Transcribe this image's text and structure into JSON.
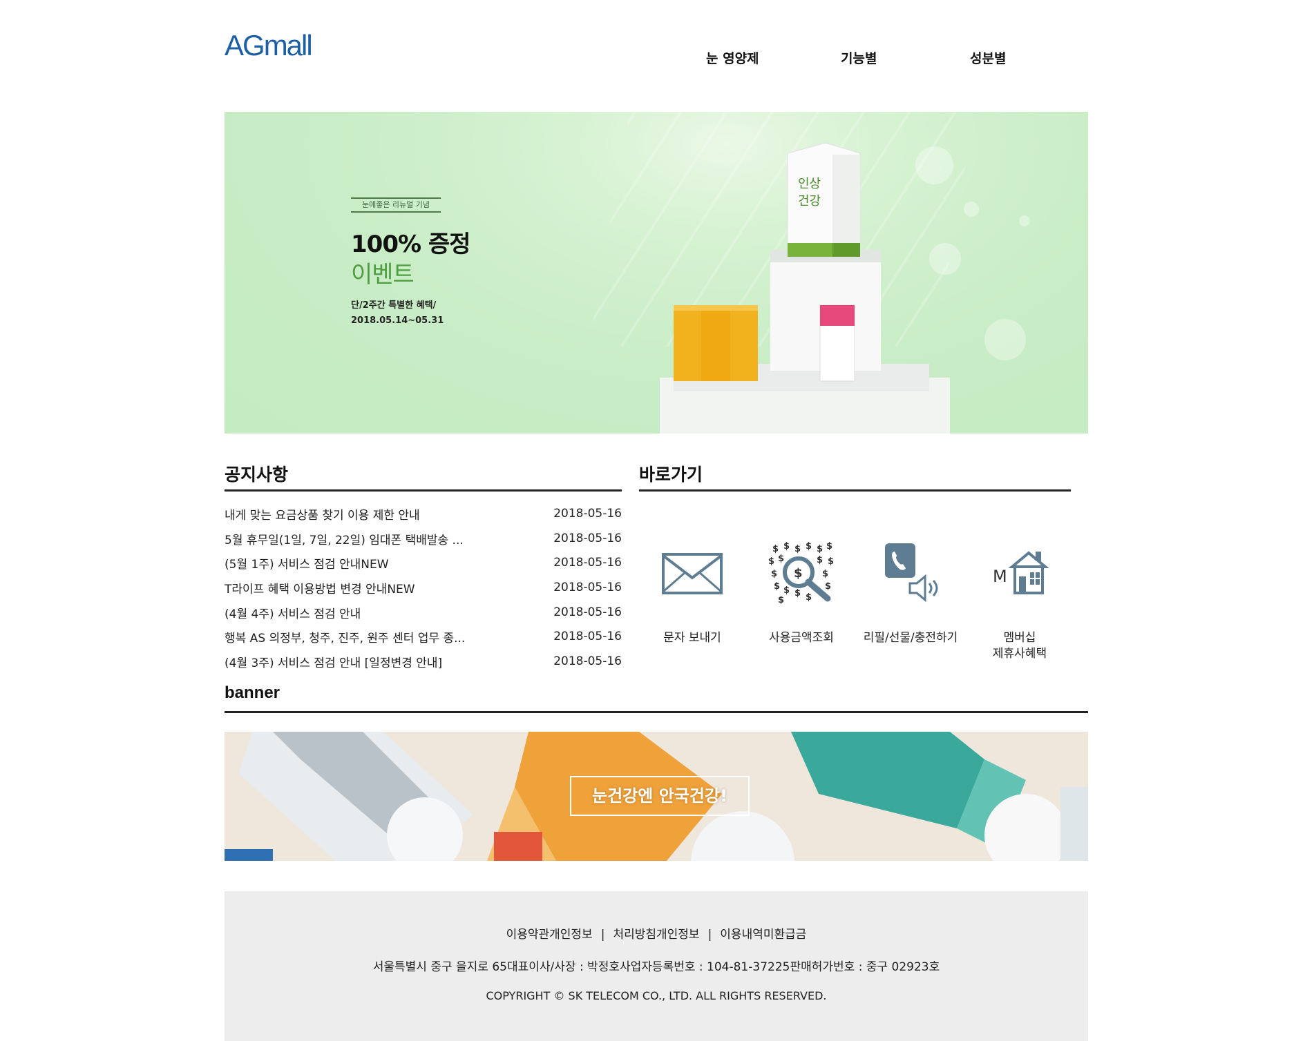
{
  "header": {
    "logo_ag": "AG",
    "logo_mall": "mall",
    "nav": [
      "눈 영양제",
      "기능별",
      "성분별"
    ]
  },
  "hero": {
    "tag": "눈에좋은 리뉴얼 기념",
    "title": "100% 증정",
    "subtitle": "이벤트",
    "desc_line1": "단/2주간 특별한 혜택/",
    "desc_line2": "2018.05.14~05.31"
  },
  "notice": {
    "title": "공지사항",
    "items": [
      {
        "title": "내게 맞는 요금상품 찾기 이용 제한 안내",
        "date": "2018-05-16"
      },
      {
        "title": "5월 휴무일(1일, 7일, 22일) 임대폰 택배발송 ...",
        "date": "2018-05-16"
      },
      {
        "title": "(5월 1주) 서비스 점검 안내NEW",
        "date": "2018-05-16"
      },
      {
        "title": "T라이프 혜택 이용방법 변경 안내NEW",
        "date": "2018-05-16"
      },
      {
        "title": "(4월 4주) 서비스 점검 안내",
        "date": "2018-05-16"
      },
      {
        "title": "행복 AS 의정부, 청주, 진주, 원주 센터 업무 종...",
        "date": "2018-05-16"
      },
      {
        "title": "(4월 3주) 서비스 점검 안내 [일정변경 안내]",
        "date": "2018-05-16"
      }
    ]
  },
  "shortcuts": {
    "title": "바로가기",
    "items": [
      {
        "label": "문자 보내기",
        "icon": "envelope-icon"
      },
      {
        "label": "사용금액조회",
        "icon": "money-search-icon"
      },
      {
        "label": "리필/선물/충전하기",
        "icon": "phone-speaker-icon"
      },
      {
        "label_line1": "멤버십",
        "label_line2": "제휴사혜택",
        "icon": "membership-house-icon"
      }
    ]
  },
  "banner": {
    "title": "banner",
    "button": "눈건강엔 안국건강!"
  },
  "footer": {
    "link1": "이용약관개인정보",
    "link2": "처리방침개인정보",
    "link3": "이용내역미환급금",
    "separator": "|",
    "address": "서울특별시 중구 을지로 65대표이사/사장 : 박정호사업자등록번호 : 104-81-37225판매허가번호 : 중구 02923호",
    "copyright": "COPYRIGHT © SK TELECOM CO., LTD. ALL RIGHTS RESERVED."
  },
  "colors": {
    "brand_blue": "#1d5fa6",
    "hero_green": "#c6ecc4",
    "icon_slate": "#5f7d92",
    "footer_bg": "#ededed"
  }
}
